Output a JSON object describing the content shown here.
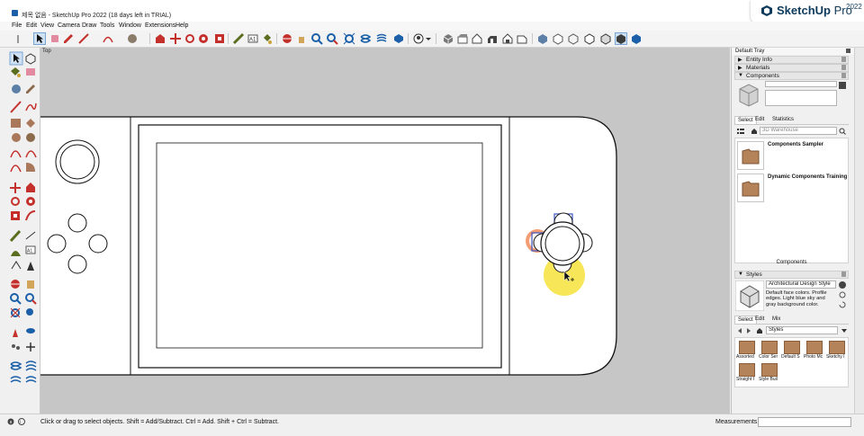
{
  "window": {
    "title": "제목 없음 - SketchUp Pro 2022 (18 days left in TRIAL)",
    "brand": {
      "name_bold": "SketchUp",
      "name_light": " Pro",
      "year": "2022"
    }
  },
  "menu": [
    "File",
    "Edit",
    "View",
    "Camera",
    "Draw",
    "Tools",
    "Window",
    "Extensions",
    "Help"
  ],
  "viewport": {
    "scene_label": "Top"
  },
  "tray": {
    "title": "Default Tray",
    "sections": {
      "entity_info": "Entity Info",
      "materials": "Materials",
      "components": "Components",
      "styles": "Styles"
    },
    "components": {
      "tabs": [
        "Select",
        "Edit",
        "Statistics"
      ],
      "search_placeholder": "3D Warehouse",
      "items": [
        "Components Sampler",
        "Dynamic Components Training"
      ],
      "footer_label": "Components"
    },
    "styles": {
      "current_name": "Architectural Design Style",
      "description": "Default face colors. Profile edges. Light blue sky and gray background color.",
      "tabs": [
        "Select",
        "Edit",
        "Mix"
      ],
      "collection": "Styles",
      "tiles": [
        "Assorted",
        "Color Ser",
        "Default S",
        "Photo Mc",
        "Sketchy I",
        "Straight I",
        "Style Buil"
      ]
    }
  },
  "status": {
    "message": "Click or drag to select objects. Shift = Add/Subtract. Ctrl = Add. Shift + Ctrl = Subtract.",
    "measurements_label": "Measurements",
    "measurements_value": ""
  },
  "colors": {
    "viewport_bg": "#c6c6c6",
    "brand_blue": "#0e3a5b",
    "selection_blue": "#3a57c4",
    "cursor_highlight": "#f6e23a",
    "inference_red": "#e8643c"
  },
  "icons": {
    "toolbar": [
      "select-arrow-icon",
      "eraser-icon",
      "pencil-icon",
      "arc-icon",
      "shape-icon",
      "push-pull-icon",
      "move-icon",
      "rotate-icon",
      "scale-icon",
      "offset-icon",
      "tape-measure-icon",
      "text-icon",
      "paint-bucket-icon",
      "orbit-icon",
      "pan-icon",
      "zoom-icon",
      "zoom-extents-icon",
      "warehouse-icon",
      "extension-icon",
      "styles-icon",
      "user-icon",
      "iso-view-icon",
      "top-view-icon",
      "front-view-icon",
      "right-view-icon",
      "back-view-icon",
      "left-view-icon",
      "xray-icon",
      "back-edges-icon",
      "wireframe-icon",
      "hidden-line-icon",
      "shaded-icon",
      "textured-icon",
      "monochrome-icon"
    ]
  }
}
